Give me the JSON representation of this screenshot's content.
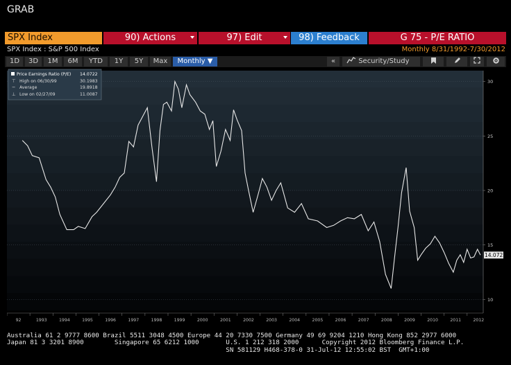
{
  "header": {
    "title": "GRAB"
  },
  "command_bar": {
    "ticker": "SPX Index",
    "actions": "90) Actions",
    "edit": "97) Edit",
    "feedback": "98) Feedback",
    "page_title": "G 75 - P/E RATIO"
  },
  "subheader": {
    "security": "SPX Index : S&P 500 Index",
    "period": "Monthly  8/31/1992-7/30/2012"
  },
  "toolbar": {
    "ranges": [
      "1D",
      "3D",
      "1M",
      "6M",
      "YTD",
      "1Y",
      "5Y",
      "Max"
    ],
    "frequency": "Monthly ▼",
    "collapse": "«",
    "security_study": "Security/Study",
    "icons": [
      "line-chart-icon",
      "bookmark-icon",
      "edit-pencil-icon",
      "expand-icon",
      "gear-icon"
    ]
  },
  "legend": {
    "rows": [
      {
        "label": "Price Earnings Ratio (P/E)",
        "value": "14.0722"
      },
      {
        "label": "High on 06/30/99",
        "value": "30.1983"
      },
      {
        "label": "Average",
        "value": "19.8918"
      },
      {
        "label": "Low on 02/27/09",
        "value": "11.0087"
      }
    ]
  },
  "last_value_badge": "14.0722",
  "chart_data": {
    "type": "line",
    "ylim": [
      9,
      31
    ],
    "yticks": [
      10,
      15,
      20,
      25,
      30
    ],
    "xlim": [
      1992.0,
      2012.7
    ],
    "xtick_labels": [
      "92",
      "1993",
      "1994",
      "1995",
      "1996",
      "1997",
      "1998",
      "1999",
      "2000",
      "2001",
      "2002",
      "2003",
      "2004",
      "2005",
      "2006",
      "2007",
      "2008",
      "2009",
      "2010",
      "2011",
      "2012"
    ],
    "series": [
      {
        "name": "Price Earnings Ratio (P/E)",
        "color": "#e8e8e8",
        "x": [
          1992.67,
          1992.9,
          1993.1,
          1993.4,
          1993.7,
          1993.9,
          1994.1,
          1994.3,
          1994.6,
          1994.9,
          1995.1,
          1995.4,
          1995.7,
          1995.9,
          1996.2,
          1996.5,
          1996.7,
          1996.9,
          1997.1,
          1997.3,
          1997.5,
          1997.7,
          1997.9,
          1998.1,
          1998.3,
          1998.5,
          1998.65,
          1998.8,
          1998.95,
          1999.15,
          1999.3,
          1999.45,
          1999.6,
          1999.8,
          1999.95,
          2000.2,
          2000.4,
          2000.6,
          2000.8,
          2000.95,
          2001.1,
          2001.3,
          2001.5,
          2001.7,
          2001.85,
          2002.0,
          2002.2,
          2002.35,
          2002.5,
          2002.7,
          2002.9,
          2003.1,
          2003.3,
          2003.5,
          2003.7,
          2003.9,
          2004.2,
          2004.5,
          2004.8,
          2005.1,
          2005.5,
          2005.9,
          2006.2,
          2006.5,
          2006.8,
          2007.1,
          2007.4,
          2007.7,
          2007.95,
          2008.2,
          2008.45,
          2008.7,
          2008.85,
          2009.0,
          2009.15,
          2009.35,
          2009.5,
          2009.7,
          2009.85,
          2010.0,
          2010.2,
          2010.4,
          2010.6,
          2010.8,
          2011.0,
          2011.2,
          2011.4,
          2011.55,
          2011.7,
          2011.85,
          2012.0,
          2012.15,
          2012.3,
          2012.45,
          2012.58
        ],
        "y": [
          24.6,
          24.1,
          23.2,
          23.0,
          21.0,
          20.3,
          19.4,
          17.8,
          16.4,
          16.4,
          16.7,
          16.5,
          17.6,
          18.0,
          18.8,
          19.6,
          20.3,
          21.2,
          21.6,
          24.5,
          24.0,
          26.0,
          26.8,
          27.6,
          24.0,
          20.8,
          25.5,
          27.9,
          28.1,
          27.3,
          30.0,
          29.3,
          27.6,
          29.7,
          28.8,
          28.1,
          27.3,
          27.0,
          25.6,
          26.4,
          22.2,
          23.6,
          25.6,
          24.6,
          27.4,
          26.5,
          25.5,
          21.6,
          20.0,
          18.0,
          19.5,
          21.1,
          20.3,
          19.1,
          20.0,
          20.7,
          18.4,
          18.0,
          18.8,
          17.4,
          17.2,
          16.6,
          16.8,
          17.2,
          17.5,
          17.4,
          17.8,
          16.3,
          17.1,
          15.3,
          12.3,
          11.0,
          13.9,
          16.7,
          19.8,
          22.1,
          18.1,
          16.6,
          13.6,
          14.1,
          14.7,
          15.1,
          15.8,
          15.2,
          14.3,
          13.3,
          12.5,
          13.6,
          14.1,
          13.4,
          14.6,
          13.8,
          13.9,
          14.6,
          14.07
        ]
      }
    ]
  },
  "footer": {
    "lines": [
      "Australia 61 2 9777 8600 Brazil 5511 3048 4500 Europe 44 20 7330 7500 Germany 49 69 9204 1210 Hong Kong 852 2977 6000",
      "Japan 81 3 3201 8900        Singapore 65 6212 1000       U.S. 1 212 318 2000      Copyright 2012 Bloomberg Finance L.P.",
      "                                                         SN 581129 H468-378-0 31-Jul-12 12:55:02 BST  GMT+1:00"
    ]
  },
  "colors": {
    "accent_orange": "#f29b2c",
    "command_red": "#b8102b",
    "feedback_blue": "#2c7fcf",
    "line": "#e8e8e8"
  }
}
